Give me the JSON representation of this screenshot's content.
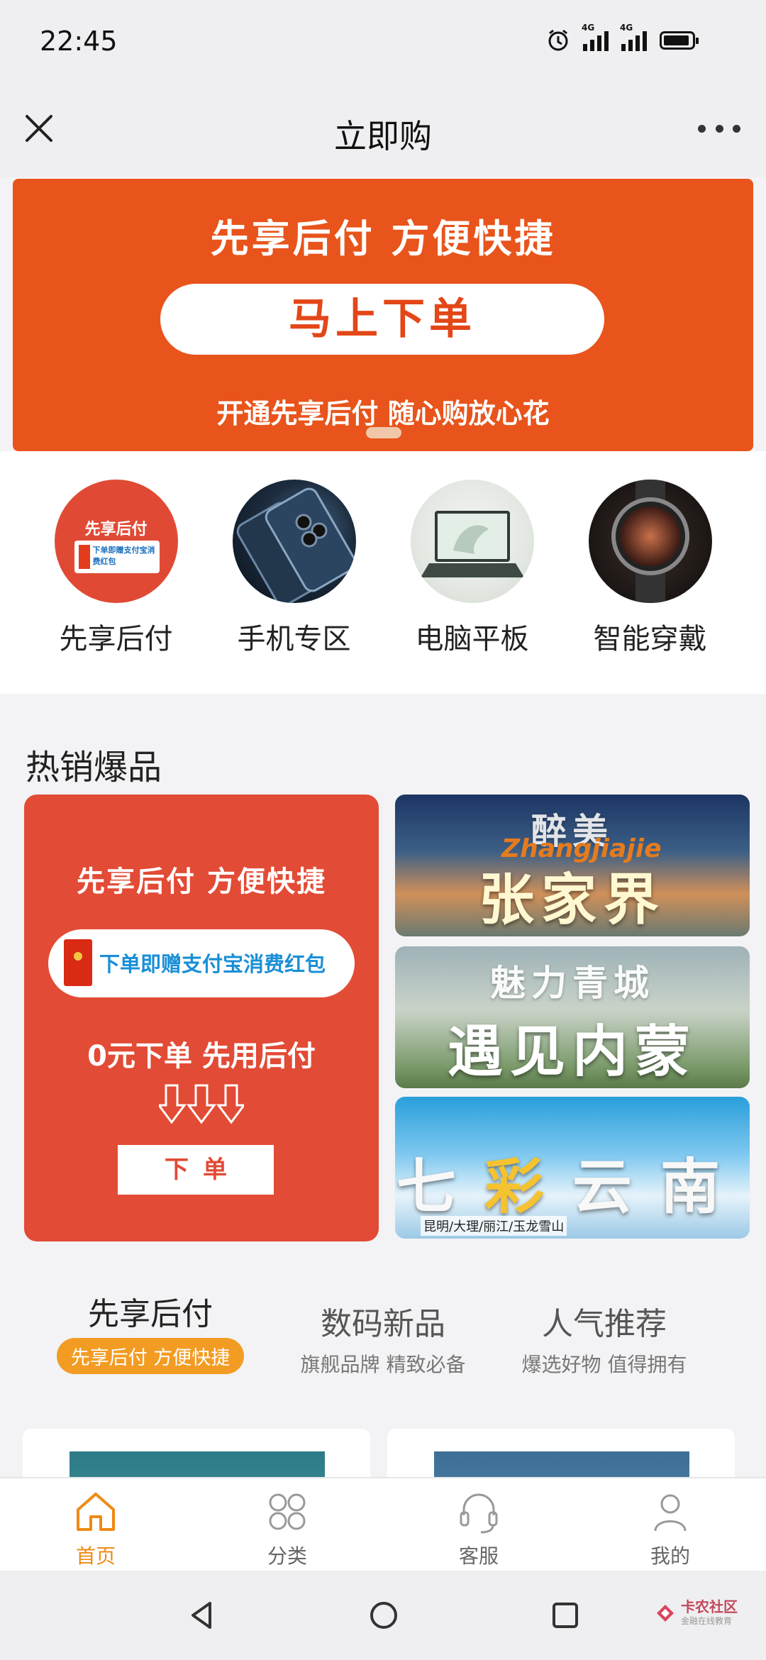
{
  "status": {
    "time": "22:45",
    "network_1": "4G",
    "network_2": "4G"
  },
  "nav": {
    "title": "立即购"
  },
  "banner": {
    "title": "先享后付  方便快捷",
    "button": "马上下单",
    "subtitle": "开通先享后付  随心购放心花"
  },
  "categories": [
    {
      "label": "先享后付",
      "icon_title": "先享后付",
      "icon_card": "下单即赠支付宝消费红包"
    },
    {
      "label": "手机专区"
    },
    {
      "label": "电脑平板"
    },
    {
      "label": "智能穿戴"
    }
  ],
  "hot": {
    "title": "热销爆品",
    "promo": {
      "title": "先享后付  方便快捷",
      "pill": "下单即赠支付宝消费红包",
      "line": "0元下单 先用后付",
      "button": "下单"
    },
    "travel": [
      {
        "top": "醉美",
        "english": "Zhangjiajie",
        "main": "张家界"
      },
      {
        "top": "魅力青城",
        "main": "遇见内蒙"
      },
      {
        "main_left": "七",
        "main_mid": "彩",
        "main_right": "云南",
        "caption": "昆明/大理/丽江/玉龙雪山"
      }
    ]
  },
  "tabs": [
    {
      "title": "先享后付",
      "subtitle": "先享后付 方便快捷",
      "active": true
    },
    {
      "title": "数码新品",
      "subtitle": "旗舰品牌 精致必备",
      "active": false
    },
    {
      "title": "人气推荐",
      "subtitle": "爆选好物 值得拥有",
      "active": false
    }
  ],
  "bottom_nav": [
    {
      "label": "首页",
      "icon": "home-icon",
      "active": true
    },
    {
      "label": "分类",
      "icon": "grid-icon",
      "active": false
    },
    {
      "label": "客服",
      "icon": "headset-icon",
      "active": false
    },
    {
      "label": "我的",
      "icon": "user-icon",
      "active": false
    }
  ],
  "watermark": {
    "title": "卡农社区",
    "subtitle": "金融在线教育"
  },
  "colors": {
    "accent": "#e8541b",
    "promo": "#e24b35",
    "active_tab": "#ef8a16"
  }
}
